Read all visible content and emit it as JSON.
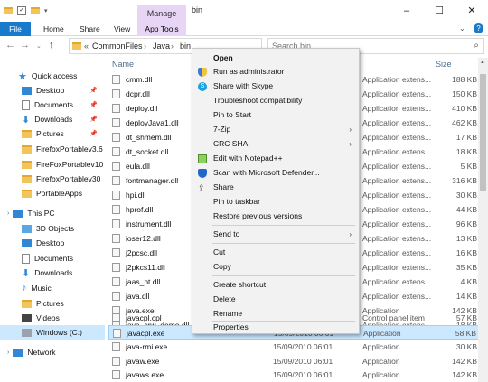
{
  "window": {
    "title": "bin",
    "manage_tab": "Manage",
    "minimize": "–",
    "maximize": "☐",
    "close": "✕"
  },
  "ribbon": {
    "tabs": [
      "File",
      "Home",
      "Share",
      "View"
    ],
    "app_tools": "App Tools"
  },
  "address": {
    "chevrons": "«",
    "segments": [
      "CommonFiles",
      "Java",
      "bin"
    ],
    "separator": "›",
    "search_placeholder": "Search bin"
  },
  "nav": {
    "items": [
      {
        "label": "Quick access",
        "icon": "star-icon"
      },
      {
        "label": "Desktop",
        "icon": "desktop-icon",
        "pinned": true
      },
      {
        "label": "Documents",
        "icon": "documents-icon",
        "pinned": true
      },
      {
        "label": "Downloads",
        "icon": "downloads-icon",
        "pinned": true
      },
      {
        "label": "Pictures",
        "icon": "pictures-icon",
        "pinned": true
      },
      {
        "label": "FirefoxPortablev3.6",
        "icon": "folder-icon"
      },
      {
        "label": "FireFoxPortablev10",
        "icon": "folder-icon"
      },
      {
        "label": "FirefoxPortablev30",
        "icon": "folder-icon"
      },
      {
        "label": "PortableApps",
        "icon": "folder-icon"
      },
      {
        "label": "This PC",
        "icon": "computer-icon"
      },
      {
        "label": "3D Objects",
        "icon": "3d-objects-icon"
      },
      {
        "label": "Desktop",
        "icon": "desktop-icon"
      },
      {
        "label": "Documents",
        "icon": "documents-icon"
      },
      {
        "label": "Downloads",
        "icon": "downloads-icon"
      },
      {
        "label": "Music",
        "icon": "music-icon"
      },
      {
        "label": "Pictures",
        "icon": "pictures-icon"
      },
      {
        "label": "Videos",
        "icon": "videos-icon"
      },
      {
        "label": "Windows (C:)",
        "icon": "drive-icon"
      },
      {
        "label": "Network",
        "icon": "network-icon"
      }
    ],
    "pin_glyph": "📌"
  },
  "columns": {
    "name": "Name",
    "size": "Size"
  },
  "files": [
    {
      "name": "cmm.dll",
      "date": "",
      "type": "Application extens...",
      "size": "188 KB"
    },
    {
      "name": "dcpr.dll",
      "date": "",
      "type": "Application extens...",
      "size": "150 KB"
    },
    {
      "name": "deploy.dll",
      "date": "",
      "type": "Application extens...",
      "size": "410 KB"
    },
    {
      "name": "deployJava1.dll",
      "date": "",
      "type": "Application extens...",
      "size": "462 KB"
    },
    {
      "name": "dt_shmem.dll",
      "date": "",
      "type": "Application extens...",
      "size": "17 KB"
    },
    {
      "name": "dt_socket.dll",
      "date": "",
      "type": "Application extens...",
      "size": "18 KB"
    },
    {
      "name": "eula.dll",
      "date": "",
      "type": "Application extens...",
      "size": "5 KB"
    },
    {
      "name": "fontmanager.dll",
      "date": "",
      "type": "Application extens...",
      "size": "316 KB"
    },
    {
      "name": "hpi.dll",
      "date": "",
      "type": "Application extens...",
      "size": "30 KB"
    },
    {
      "name": "hprof.dll",
      "date": "",
      "type": "Application extens...",
      "size": "44 KB"
    },
    {
      "name": "instrument.dll",
      "date": "",
      "type": "Application extens...",
      "size": "96 KB"
    },
    {
      "name": "ioser12.dll",
      "date": "",
      "type": "Application extens...",
      "size": "13 KB"
    },
    {
      "name": "j2pcsc.dll",
      "date": "",
      "type": "Application extens...",
      "size": "16 KB"
    },
    {
      "name": "j2pkcs11.dll",
      "date": "",
      "type": "Application extens...",
      "size": "35 KB"
    },
    {
      "name": "jaas_nt.dll",
      "date": "",
      "type": "Application extens...",
      "size": "4 KB"
    },
    {
      "name": "java.dll",
      "date": "",
      "type": "Application extens...",
      "size": "14 KB"
    },
    {
      "name": "java.exe",
      "date": "",
      "type": "Application",
      "size": "142 KB"
    },
    {
      "name": "java_crw_demo.dll",
      "date": "",
      "type": "Application extens...",
      "size": "18 KB"
    },
    {
      "name": "javacpl.cpl",
      "date": "",
      "type": "Control panel item",
      "size": "57 KB"
    },
    {
      "name": "javacpl.exe",
      "date": "15/09/2010 06:01",
      "type": "Application",
      "size": "58 KB",
      "selected": true
    },
    {
      "name": "java-rmi.exe",
      "date": "15/09/2010 06:01",
      "type": "Application",
      "size": "30 KB"
    },
    {
      "name": "javaw.exe",
      "date": "15/09/2010 06:01",
      "type": "Application",
      "size": "142 KB"
    },
    {
      "name": "javaws.exe",
      "date": "15/09/2010 06:01",
      "type": "Application",
      "size": "142 KB"
    }
  ],
  "context_menu": {
    "items": [
      {
        "label": "Open",
        "bold": true,
        "icon": ""
      },
      {
        "label": "Run as administrator",
        "icon": "shield-icon"
      },
      {
        "label": "Share with Skype",
        "icon": "skype-icon"
      },
      {
        "label": "Troubleshoot compatibility",
        "icon": ""
      },
      {
        "label": "Pin to Start",
        "icon": ""
      },
      {
        "label": "7-Zip",
        "icon": "",
        "submenu": true
      },
      {
        "label": "CRC SHA",
        "icon": "",
        "submenu": true
      },
      {
        "label": "Edit with Notepad++",
        "icon": "notepad-plus-icon"
      },
      {
        "label": "Scan with Microsoft Defender...",
        "icon": "defender-icon"
      },
      {
        "label": "Share",
        "icon": "share-icon"
      },
      {
        "label": "Pin to taskbar",
        "icon": ""
      },
      {
        "label": "Restore previous versions",
        "icon": ""
      },
      {
        "label": "Send to",
        "icon": "",
        "submenu": true,
        "separator_before": true
      },
      {
        "label": "Cut",
        "icon": "",
        "separator_before": true
      },
      {
        "label": "Copy",
        "icon": ""
      },
      {
        "label": "Create shortcut",
        "icon": "",
        "separator_before": true
      },
      {
        "label": "Delete",
        "icon": ""
      },
      {
        "label": "Rename",
        "icon": ""
      },
      {
        "label": "Properties",
        "icon": "",
        "separator_before": true
      }
    ],
    "submenu_arrow": "›"
  },
  "colors": {
    "file_tab": "#1979ca",
    "manage_tab": "#e8d5f5",
    "selection": "#cce8ff",
    "selection_border": "#99d1ff",
    "folder": "#f2c55c",
    "menu_bg": "#f2f2f2"
  }
}
